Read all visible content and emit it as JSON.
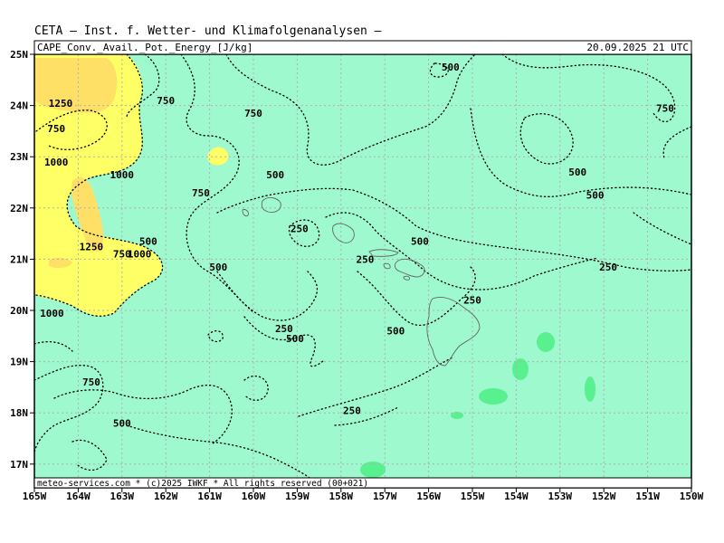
{
  "header": {
    "title": "CETA — Inst. f. Wetter- und Klimafolgenanalysen —",
    "field_label": "CAPE_Conv._Avail._Pot._Energy_[J/kg]",
    "valid_time": "20.09.2025 21 UTC",
    "footer": "meteo-services.com * (c)2025 IWKF * All rights reserved (00+021)"
  },
  "map": {
    "lon_labels": [
      "165W",
      "164W",
      "163W",
      "162W",
      "161W",
      "160W",
      "159W",
      "158W",
      "157W",
      "156W",
      "155W",
      "154W",
      "153W",
      "152W",
      "151W",
      "150W"
    ],
    "lat_labels": [
      "25N",
      "24N",
      "23N",
      "22N",
      "21N",
      "20N",
      "19N",
      "18N",
      "17N"
    ],
    "colors": {
      "background_fill": "#9ff9cf",
      "cape_1000_fill": "#ffff66",
      "cape_1250_fill": "#ffe066",
      "cape_low_fill": "#59f08f",
      "grid": "#b0b0b0",
      "contour": "#000000",
      "coast": "#666666"
    },
    "contour_labels": [
      {
        "text": "500",
        "lon": -155.5,
        "lat": 24.75
      },
      {
        "text": "1250",
        "lon": -164.4,
        "lat": 24.05
      },
      {
        "text": "750",
        "lon": -162.0,
        "lat": 24.1
      },
      {
        "text": "750",
        "lon": -160.0,
        "lat": 23.85
      },
      {
        "text": "750",
        "lon": -164.5,
        "lat": 23.55
      },
      {
        "text": "750",
        "lon": -150.6,
        "lat": 23.95
      },
      {
        "text": "1000",
        "lon": -164.5,
        "lat": 22.9
      },
      {
        "text": "1000",
        "lon": -163.0,
        "lat": 22.65
      },
      {
        "text": "500",
        "lon": -159.5,
        "lat": 22.65
      },
      {
        "text": "500",
        "lon": -152.6,
        "lat": 22.7
      },
      {
        "text": "500",
        "lon": -152.2,
        "lat": 22.25
      },
      {
        "text": "750",
        "lon": -161.2,
        "lat": 22.3
      },
      {
        "text": "250",
        "lon": -158.95,
        "lat": 21.6
      },
      {
        "text": "500",
        "lon": -162.4,
        "lat": 21.35
      },
      {
        "text": "500",
        "lon": -156.2,
        "lat": 21.35
      },
      {
        "text": "1250",
        "lon": -163.7,
        "lat": 21.25
      },
      {
        "text": "750",
        "lon": -163.0,
        "lat": 21.1
      },
      {
        "text": "1000",
        "lon": -162.6,
        "lat": 21.1
      },
      {
        "text": "250",
        "lon": -157.45,
        "lat": 21.0
      },
      {
        "text": "500",
        "lon": -160.8,
        "lat": 20.85
      },
      {
        "text": "250",
        "lon": -151.9,
        "lat": 20.85
      },
      {
        "text": "250",
        "lon": -155.0,
        "lat": 20.2
      },
      {
        "text": "1000",
        "lon": -164.6,
        "lat": 19.95
      },
      {
        "text": "250",
        "lon": -159.3,
        "lat": 19.65
      },
      {
        "text": "500",
        "lon": -156.75,
        "lat": 19.6
      },
      {
        "text": "500",
        "lon": -159.05,
        "lat": 19.45
      },
      {
        "text": "750",
        "lon": -163.7,
        "lat": 18.6
      },
      {
        "text": "250",
        "lon": -157.75,
        "lat": 18.05
      },
      {
        "text": "500",
        "lon": -163.0,
        "lat": 17.8
      }
    ]
  }
}
